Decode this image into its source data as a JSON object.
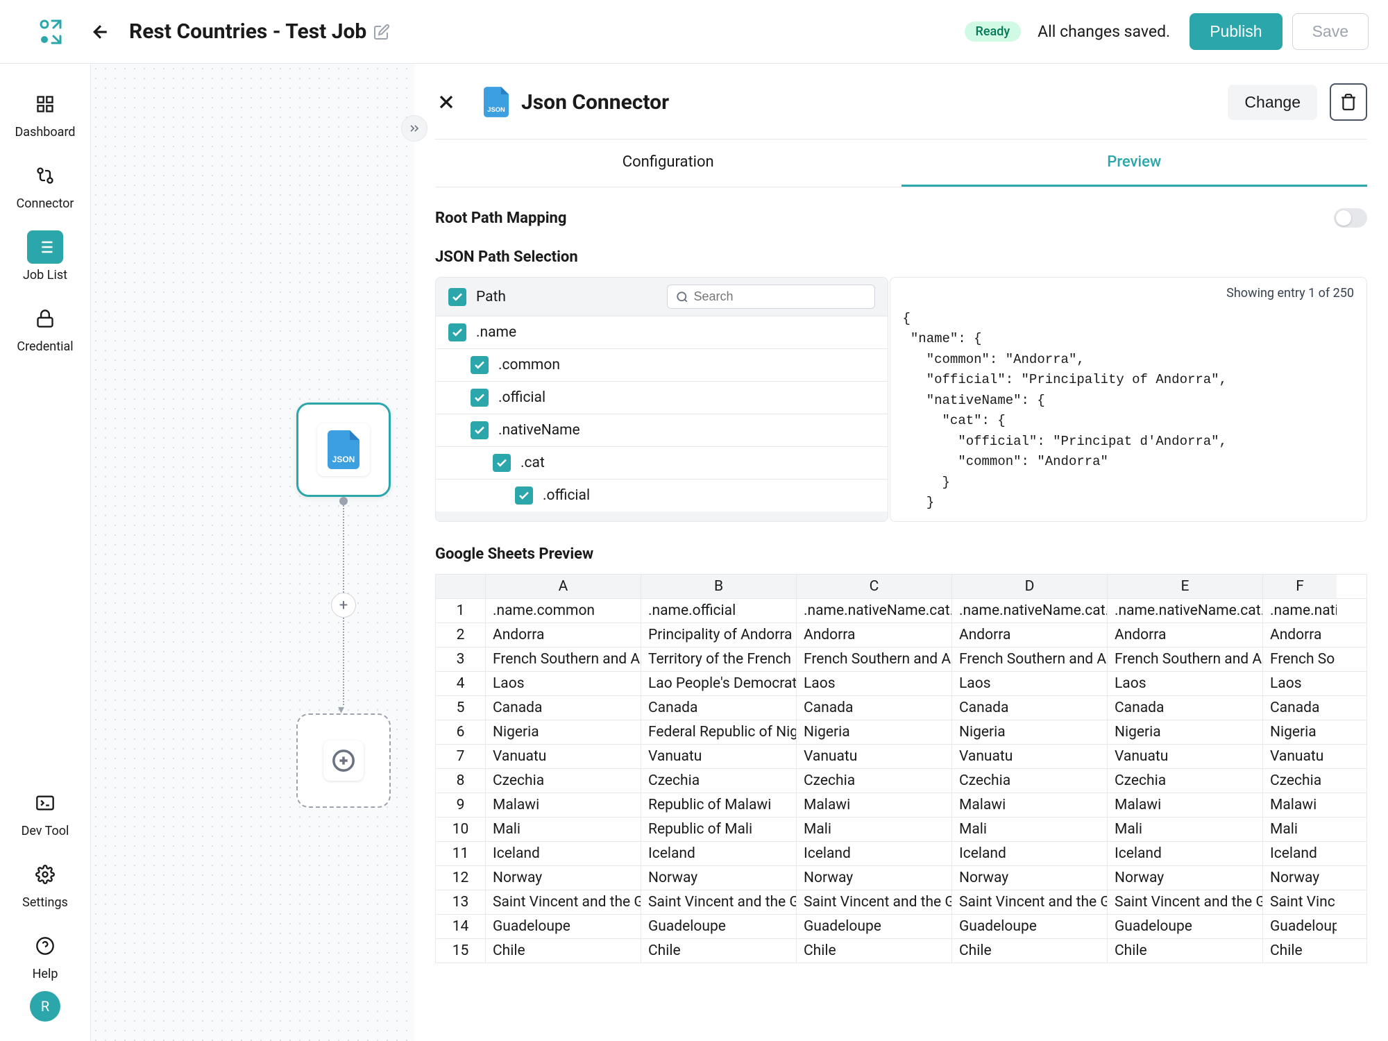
{
  "header": {
    "page_title": "Rest Countries - Test Job",
    "status_badge": "Ready",
    "status_text": "All changes saved.",
    "publish_label": "Publish",
    "save_label": "Save"
  },
  "sidebar": {
    "items": [
      {
        "label": "Dashboard"
      },
      {
        "label": "Connector"
      },
      {
        "label": "Job List"
      },
      {
        "label": "Credential"
      }
    ],
    "bottom_items": [
      {
        "label": "Dev Tool"
      },
      {
        "label": "Settings"
      },
      {
        "label": "Help"
      }
    ],
    "avatar_initial": "R"
  },
  "canvas": {
    "plus_label": "+"
  },
  "panel": {
    "title": "Json Connector",
    "change_label": "Change",
    "tabs": {
      "configuration": "Configuration",
      "preview": "Preview"
    },
    "root_path_heading": "Root Path Mapping",
    "json_path_heading": "JSON Path Selection",
    "path_header_label": "Path",
    "search_placeholder": "Search",
    "paths": [
      {
        "label": ".name",
        "indent": 1
      },
      {
        "label": ".common",
        "indent": 2
      },
      {
        "label": ".official",
        "indent": 2
      },
      {
        "label": ".nativeName",
        "indent": 2
      },
      {
        "label": ".cat",
        "indent": 3
      },
      {
        "label": ".official",
        "indent": 4
      }
    ],
    "entry_count": "Showing entry 1 of 250",
    "json_preview": "{\n \"name\": {\n   \"common\": \"Andorra\",\n   \"official\": \"Principality of Andorra\",\n   \"nativeName\": {\n     \"cat\": {\n       \"official\": \"Principat d'Andorra\",\n       \"common\": \"Andorra\"\n     }\n   }",
    "sheets_heading": "Google Sheets Preview",
    "columns": [
      "A",
      "B",
      "C",
      "D",
      "E",
      "F"
    ],
    "header_row": [
      ".name.common",
      ".name.official",
      ".name.nativeName.cat.",
      ".name.nativeName.cat.",
      ".name.nativeName.cat.",
      ".name.nati"
    ],
    "rows": [
      [
        "Andorra",
        "Principality of Andorra",
        "Andorra",
        "Andorra",
        "Andorra",
        "Andorra"
      ],
      [
        "French Southern and A",
        "Territory of the French",
        "French Southern and A",
        "French Southern and A",
        "French Southern and A",
        "French So"
      ],
      [
        "Laos",
        "Lao People's Democrat",
        "Laos",
        "Laos",
        "Laos",
        "Laos"
      ],
      [
        "Canada",
        "Canada",
        "Canada",
        "Canada",
        "Canada",
        "Canada"
      ],
      [
        "Nigeria",
        "Federal Republic of Nig",
        "Nigeria",
        "Nigeria",
        "Nigeria",
        "Nigeria"
      ],
      [
        "Vanuatu",
        "Vanuatu",
        "Vanuatu",
        "Vanuatu",
        "Vanuatu",
        "Vanuatu"
      ],
      [
        "Czechia",
        "Czechia",
        "Czechia",
        "Czechia",
        "Czechia",
        "Czechia"
      ],
      [
        "Malawi",
        "Republic of Malawi",
        "Malawi",
        "Malawi",
        "Malawi",
        "Malawi"
      ],
      [
        "Mali",
        "Republic of Mali",
        "Mali",
        "Mali",
        "Mali",
        "Mali"
      ],
      [
        "Iceland",
        "Iceland",
        "Iceland",
        "Iceland",
        "Iceland",
        "Iceland"
      ],
      [
        "Norway",
        "Norway",
        "Norway",
        "Norway",
        "Norway",
        "Norway"
      ],
      [
        "Saint Vincent and the G",
        "Saint Vincent and the G",
        "Saint Vincent and the G",
        "Saint Vincent and the G",
        "Saint Vincent and the G",
        "Saint Vinc"
      ],
      [
        "Guadeloupe",
        "Guadeloupe",
        "Guadeloupe",
        "Guadeloupe",
        "Guadeloupe",
        "Guadeloup"
      ],
      [
        "Chile",
        "Chile",
        "Chile",
        "Chile",
        "Chile",
        "Chile"
      ]
    ]
  }
}
